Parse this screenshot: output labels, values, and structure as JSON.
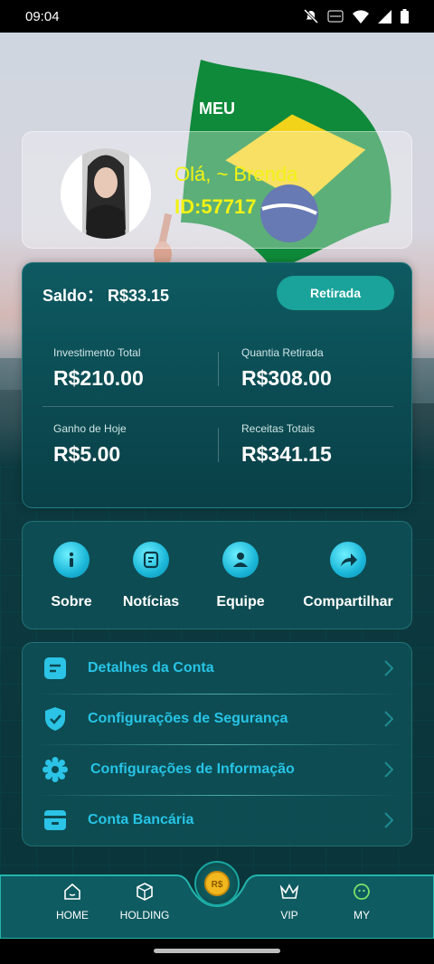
{
  "status_bar": {
    "time": "09:04"
  },
  "page": {
    "title": "MEU"
  },
  "profile": {
    "greeting": "Olá, ~ Brenda",
    "id": "ID:57717"
  },
  "balance": {
    "label": "Saldo： R$33.15",
    "withdraw_label": "Retirada",
    "stats": [
      {
        "label": "Investimento Total",
        "value": "R$210.00"
      },
      {
        "label": "Quantia Retirada",
        "value": "R$308.00"
      },
      {
        "label": "Ganho de Hoje",
        "value": "R$5.00"
      },
      {
        "label": "Receitas Totais",
        "value": "R$341.15"
      }
    ]
  },
  "actions": [
    {
      "label": "Sobre",
      "icon": "info-icon"
    },
    {
      "label": "Notícias",
      "icon": "news-icon"
    },
    {
      "label": "Equipe",
      "icon": "team-icon"
    },
    {
      "label": "Compartilhar",
      "icon": "share-icon"
    }
  ],
  "menu": [
    {
      "label": "Detalhes da Conta",
      "icon": "account-details-icon"
    },
    {
      "label": "Configurações de Segurança",
      "icon": "shield-check-icon"
    },
    {
      "label": "Configurações de Informação",
      "icon": "gear-icon"
    },
    {
      "label": "Conta Bancária",
      "icon": "bank-card-icon"
    }
  ],
  "bottom_nav": [
    {
      "label": "HOME",
      "icon": "home-icon"
    },
    {
      "label": "HOLDING",
      "icon": "box-icon"
    },
    {
      "label": "",
      "icon": "coin-icon",
      "coin_text": "R$"
    },
    {
      "label": "VIP",
      "icon": "crown-icon"
    },
    {
      "label": "MY",
      "icon": "smiley-icon",
      "active": true
    }
  ],
  "colors": {
    "accent": "#1aa39a",
    "highlight_text": "#f3f315",
    "menu_text": "#27c4e6",
    "active_nav": "#7be36b"
  }
}
